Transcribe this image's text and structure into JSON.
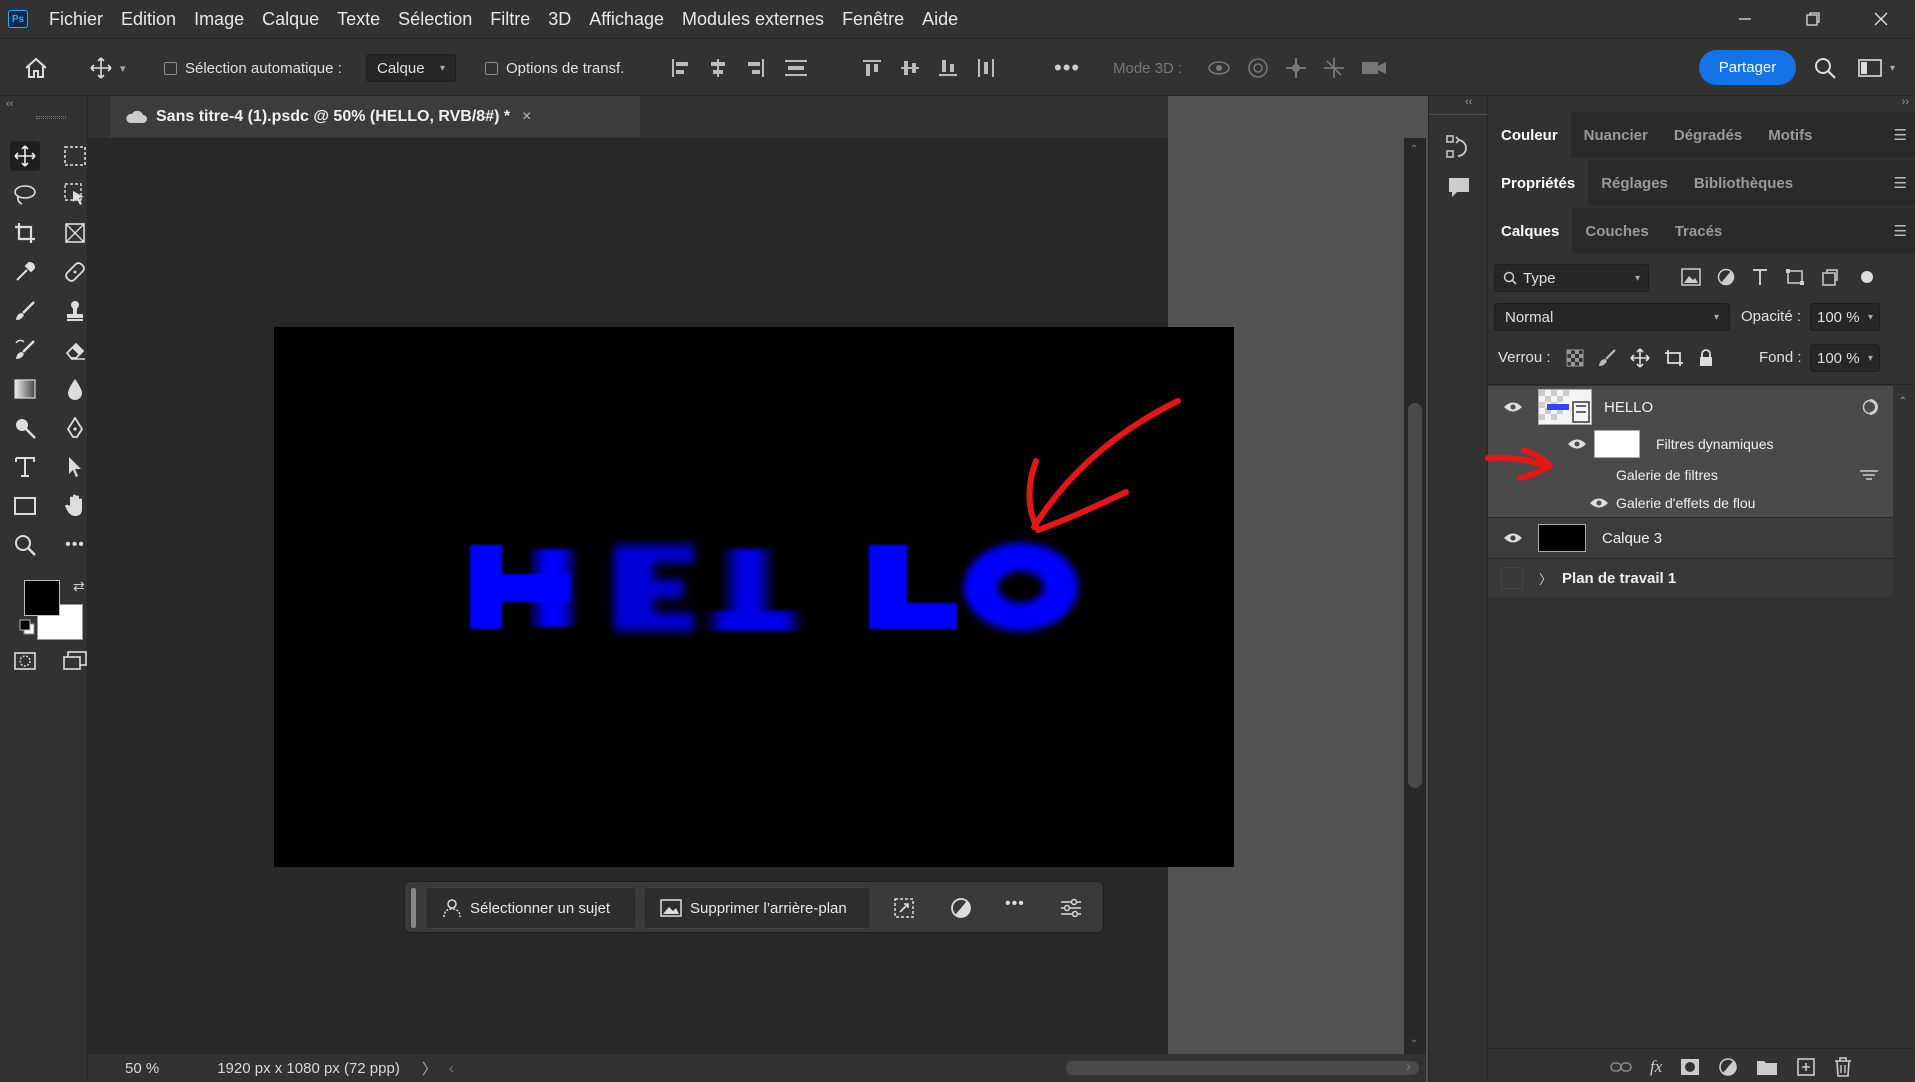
{
  "app": {
    "logo": "Ps"
  },
  "menu": [
    "Fichier",
    "Edition",
    "Image",
    "Calque",
    "Texte",
    "Sélection",
    "Filtre",
    "3D",
    "Affichage",
    "Modules externes",
    "Fenêtre",
    "Aide"
  ],
  "options": {
    "auto_select_label": "Sélection automatique :",
    "auto_select_value": "Calque",
    "transform_label": "Options de transf.",
    "mode3d_label": "Mode 3D :",
    "share_label": "Partager"
  },
  "document": {
    "tab_title": "Sans titre-4 (1).psdc @ 50% (HELLO, RVB/8#) *",
    "canvas_text": "HELLO",
    "text_color": "#0000ff"
  },
  "taskbar": {
    "select_subject": "Sélectionner un sujet",
    "remove_background": "Supprimer l’arrière-plan"
  },
  "status": {
    "zoom": "50 %",
    "dimensions": "1920 px x 1080 px (72 ppp)"
  },
  "panels": {
    "group1_tabs": [
      "Couleur",
      "Nuancier",
      "Dégradés",
      "Motifs"
    ],
    "group2_tabs": [
      "Propriétés",
      "Réglages",
      "Bibliothèques"
    ],
    "group3_tabs": [
      "Calques",
      "Couches",
      "Tracés"
    ],
    "filter_kind": "Type",
    "blend_mode": "Normal",
    "opacity_label": "Opacité :",
    "opacity_value": "100 %",
    "lock_label": "Verrou :",
    "fill_label": "Fond :",
    "fill_value": "100 %"
  },
  "layers": {
    "hello": "HELLO",
    "smart_filters": "Filtres dynamiques",
    "filter_gallery": "Galerie de filtres",
    "blur_gallery": "Galerie d'effets de flou",
    "calque3": "Calque 3",
    "artboard": "Plan de travail 1"
  },
  "annotation_color": "#e01818"
}
